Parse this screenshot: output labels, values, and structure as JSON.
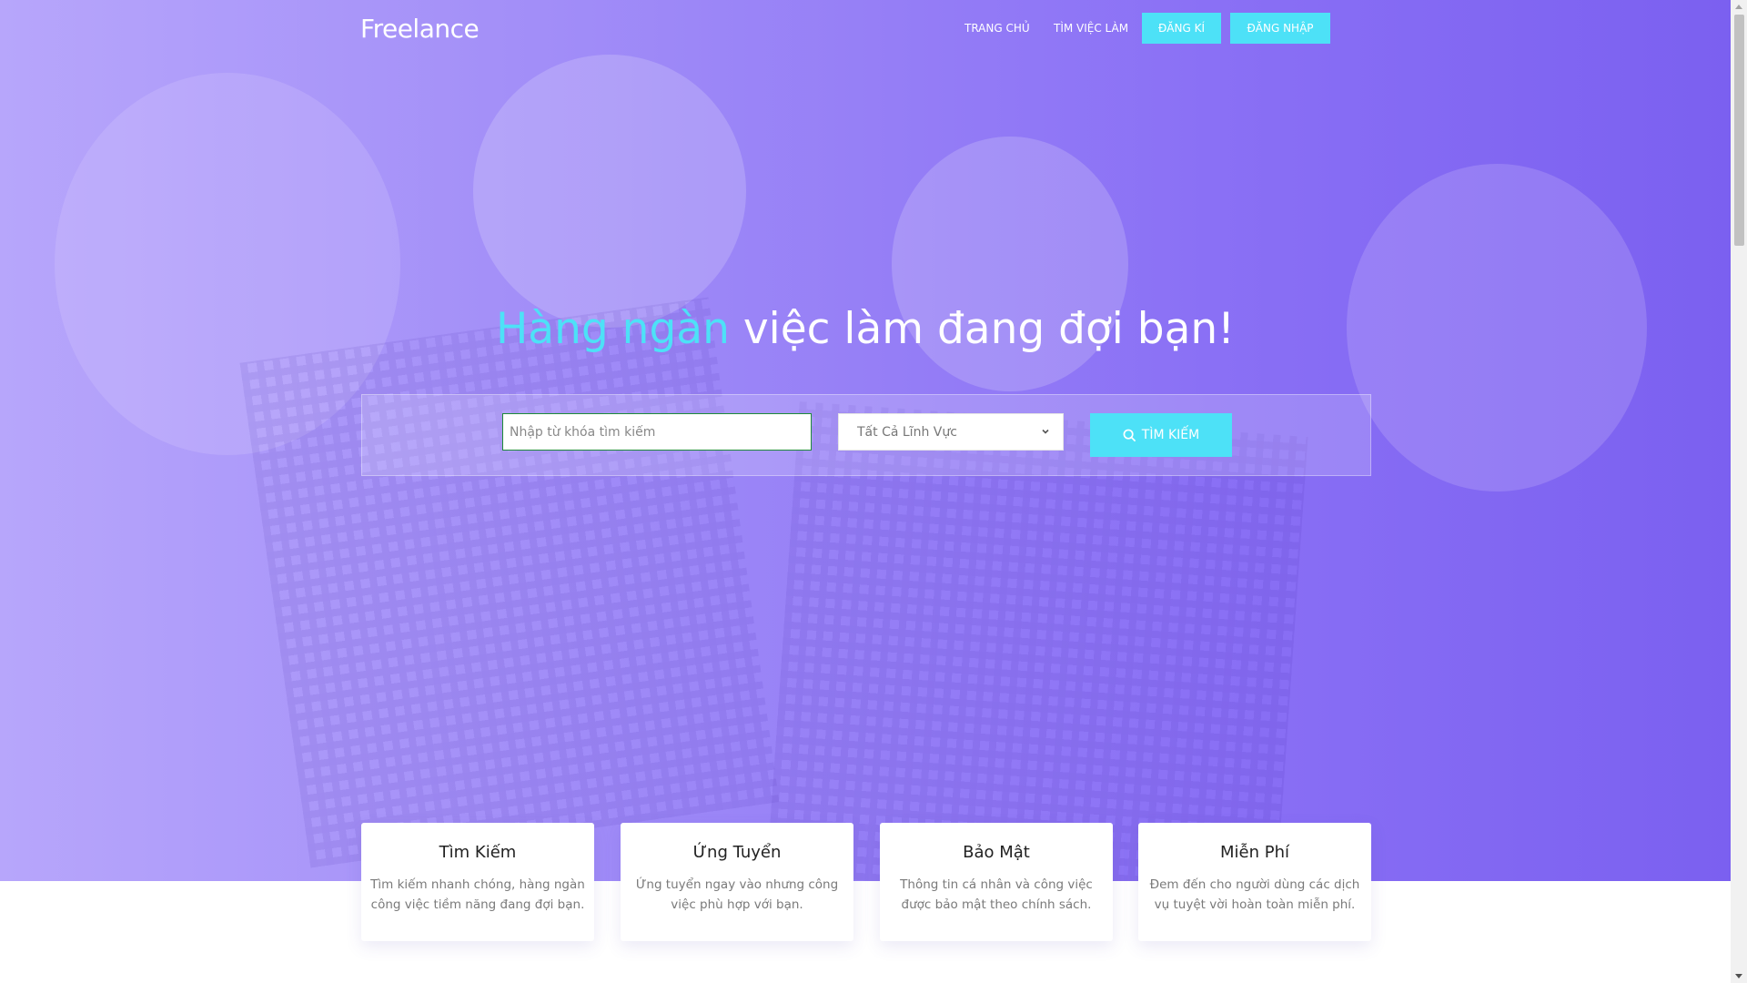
{
  "brand": {
    "logo": "Freelance",
    "accent_color": "#4de1f7",
    "hero_gradient": [
      "#b7a6fb",
      "#7b60f0"
    ]
  },
  "nav": {
    "home": "TRANG CHỦ",
    "find_jobs": "TÌM VIỆC LÀM",
    "register": "ĐĂNG KÍ",
    "login": "ĐĂNG NHẬP"
  },
  "hero": {
    "headline_accent": "Hàng ngàn",
    "headline_rest": " việc làm đang đợi bạn!"
  },
  "search": {
    "placeholder": "Nhập từ khóa tìm kiếm",
    "value": "",
    "category_selected": "Tất Cả Lĩnh Vực",
    "button_label": "TÌM KIẾM",
    "button_icon": "search-icon"
  },
  "features": [
    {
      "title": "Tìm Kiếm",
      "text": "Tìm kiếm nhanh chóng, hàng ngàn công việc tiềm năng đang đợi bạn."
    },
    {
      "title": "Ứng Tuyển",
      "text": "Ứng tuyển ngay vào nhưng công việc phù hợp với bạn."
    },
    {
      "title": "Bảo Mật",
      "text": "Thông tin cá nhân và công việc được bảo mật theo chính sách."
    },
    {
      "title": "Miễn Phí",
      "text": "Đem đến cho người dùng các dịch vụ tuyệt vời hoàn toàn miễn phí."
    }
  ]
}
